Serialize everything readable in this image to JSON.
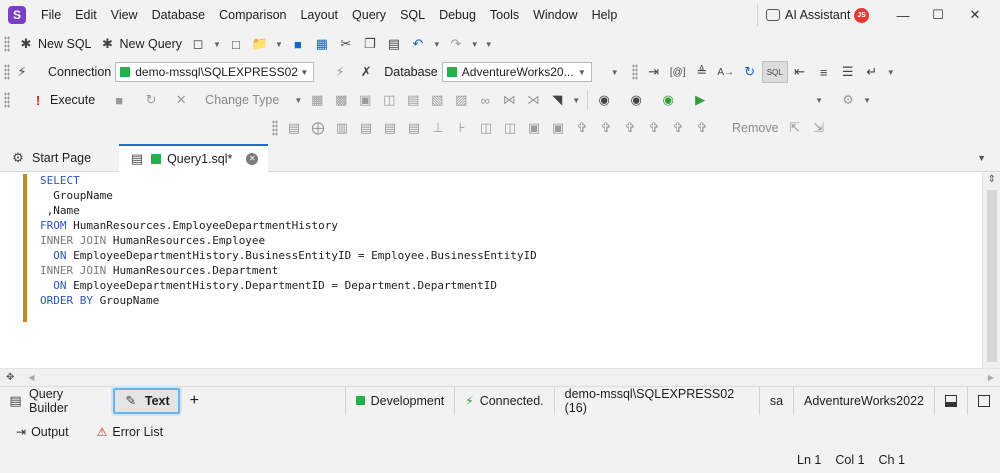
{
  "app": {
    "logo_letter": "S",
    "ai_assistant": "AI Assistant",
    "user_initials": "JS"
  },
  "menu": [
    "File",
    "Edit",
    "View",
    "Database",
    "Comparison",
    "Layout",
    "Query",
    "SQL",
    "Debug",
    "Tools",
    "Window",
    "Help"
  ],
  "toolbar1": {
    "new_sql": "New SQL",
    "new_query": "New Query"
  },
  "toolbar2": {
    "connection_label": "Connection",
    "connection_value": "demo-mssql\\SQLEXPRESS02",
    "database_label": "Database",
    "database_value": "AdventureWorks20..."
  },
  "toolbar3": {
    "execute": "Execute",
    "change_type": "Change Type"
  },
  "toolbar4": {
    "remove": "Remove"
  },
  "tabs": {
    "start_page": "Start Page",
    "query1": "Query1.sql*"
  },
  "editor": {
    "lines": [
      [
        {
          "t": "SELECT",
          "c": "kw"
        }
      ],
      [
        {
          "t": "  GroupName",
          "c": "id"
        }
      ],
      [
        {
          "t": " ,Name",
          "c": "id"
        }
      ],
      [
        {
          "t": "FROM ",
          "c": "kw"
        },
        {
          "t": "HumanResources.EmployeeDepartmentHistory",
          "c": "id"
        }
      ],
      [
        {
          "t": "INNER JOIN ",
          "c": "kw2"
        },
        {
          "t": "HumanResources.Employee",
          "c": "id"
        }
      ],
      [
        {
          "t": "  ON ",
          "c": "kw"
        },
        {
          "t": "EmployeeDepartmentHistory.BusinessEntityID = Employee.BusinessEntityID",
          "c": "id"
        }
      ],
      [
        {
          "t": "INNER JOIN ",
          "c": "kw2"
        },
        {
          "t": "HumanResources.Department",
          "c": "id"
        }
      ],
      [
        {
          "t": "  ON ",
          "c": "kw"
        },
        {
          "t": "EmployeeDepartmentHistory.DepartmentID = Department.DepartmentID",
          "c": "id"
        }
      ],
      [
        {
          "t": "ORDER BY ",
          "c": "kw"
        },
        {
          "t": "GroupName",
          "c": "id"
        }
      ]
    ]
  },
  "modebar": {
    "query_builder": "Query Builder",
    "text": "Text",
    "environment": "Development",
    "status": "Connected.",
    "server": "demo-mssql\\SQLEXPRESS02 (16)",
    "user": "sa",
    "database": "AdventureWorks2022"
  },
  "outbar": {
    "output": "Output",
    "error_list": "Error List"
  },
  "caret": {
    "ln": "Ln 1",
    "col": "Col 1",
    "ch": "Ch 1"
  },
  "colors": {
    "accent": "#1f6fd1",
    "connected": "#22b14c",
    "gutter": "#c8862a"
  }
}
